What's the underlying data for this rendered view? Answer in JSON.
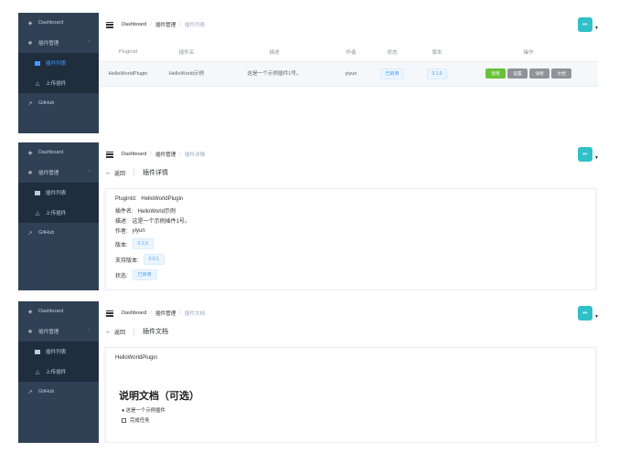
{
  "sidebar": {
    "dashboard": "Dashboard",
    "plugin_manage": "插件管理",
    "plugin_list": "插件列表",
    "upload_plugin": "上传插件",
    "github": "GitHub"
  },
  "breadcrumb": {
    "home": "Dashboard",
    "manage": "插件管理",
    "list": "插件列表",
    "detail": "插件详情",
    "doc": "插件文档"
  },
  "table": {
    "headers": [
      "PluginId",
      "插件名",
      "描述",
      "作者",
      "状态",
      "版本",
      "操作"
    ],
    "row": {
      "id": "HelloWorldPlugin",
      "name": "HelloWorld示例",
      "desc": "这是一个示例插件1号。",
      "author": "yiyun",
      "status": "已启用",
      "version": "0.1.0"
    },
    "actions": [
      "禁用",
      "设置",
      "详情",
      "文档"
    ]
  },
  "detail": {
    "back": "返回",
    "title": "插件详情",
    "id_label": "PluginId:",
    "id_value": "HelloWorldPlugin",
    "name_label": "插件名:",
    "name_value": "HelloWorld示例",
    "desc_label": "描述:",
    "desc_value": "这是一个示例插件1号。",
    "author_label": "作者:",
    "author_value": "yiyun",
    "version_label": "版本:",
    "version_value": "0.1.0",
    "support_label": "支持版本:",
    "support_value": "0.0.1",
    "status_label": "状态:",
    "status_value": "已启用"
  },
  "doc": {
    "back": "返回",
    "title": "插件文档",
    "plugin_name": "HelloWorldPlugin",
    "heading": "说明文档（可选）",
    "bullet": "● 这是一个示例插件",
    "checkbox": "完成任务"
  },
  "colors": {
    "sidebar_bg": "#304156",
    "sidebar_sub_bg": "#1f2d3d",
    "accent": "#409eff",
    "success": "#67c23a",
    "avatar": "#30c0c8"
  }
}
